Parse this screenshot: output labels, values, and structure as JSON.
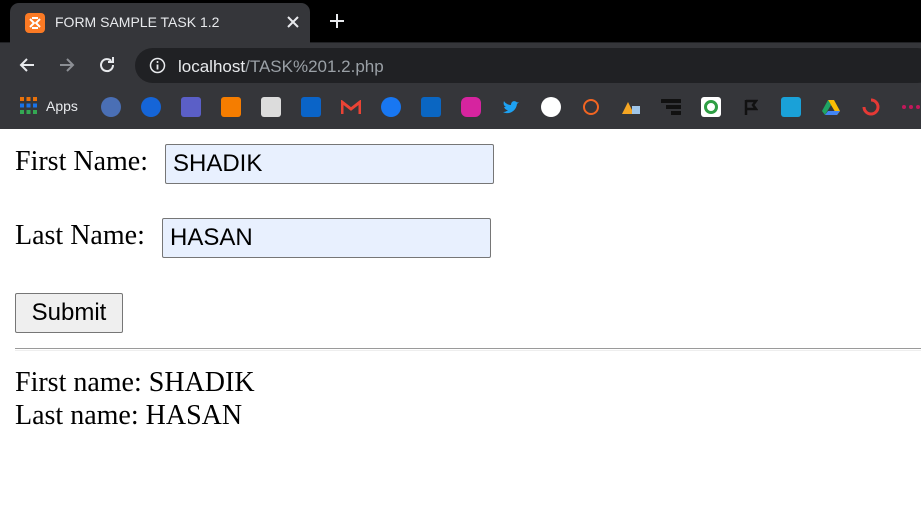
{
  "browser": {
    "tab": {
      "title": "FORM SAMPLE TASK 1.2"
    },
    "address": {
      "host": "localhost",
      "path": "/TASK%201.2.php"
    },
    "bookmarks": {
      "apps_label": "Apps"
    }
  },
  "form": {
    "first_name_label": "First Name:",
    "first_name_value": "SHADIK",
    "last_name_label": "Last Name:",
    "last_name_value": "HASAN",
    "submit_label": "Submit"
  },
  "result": {
    "first_line": "First name: SHADIK",
    "last_line": "Last name: HASAN"
  }
}
